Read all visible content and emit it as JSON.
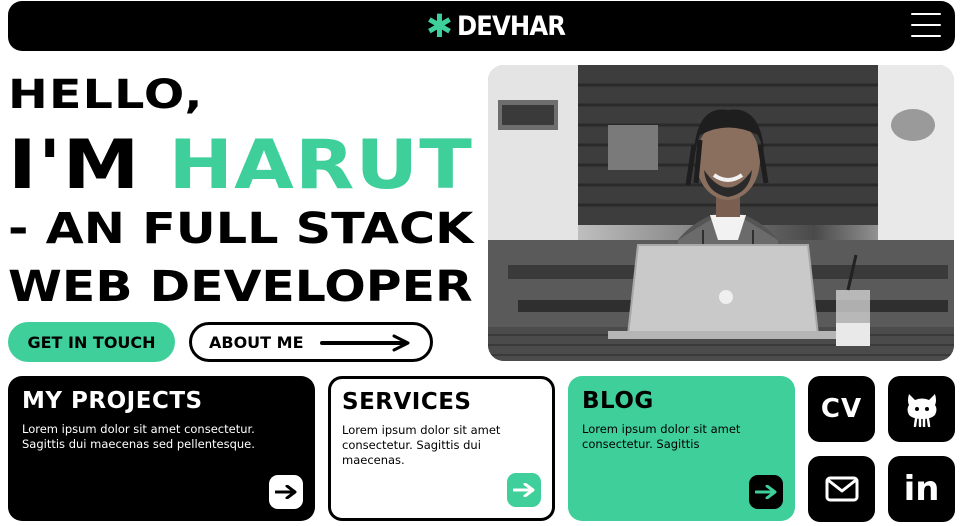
{
  "header": {
    "logo_text": "DEVHAR",
    "logo_icon": "asterisk-icon",
    "menu_icon": "hamburger-menu-icon"
  },
  "hero": {
    "line1": "HELLO,",
    "line2_prefix": "I'M ",
    "line2_name": "HARUT",
    "line3": "- AN FULL STACK",
    "line4": "WEB DEVELOPER",
    "cta_primary": "GET IN TOUCH",
    "cta_secondary": "ABOUT ME",
    "photo_icon": "portrait-photo"
  },
  "cards": {
    "projects": {
      "title": "MY PROJECTS",
      "text": "Lorem ipsum dolor sit amet consectetur. Sagittis dui maecenas sed pellentesque."
    },
    "services": {
      "title": "SERVICES",
      "text": "Lorem ipsum dolor sit amet consectetur. Sagittis dui maecenas."
    },
    "blog": {
      "title": "BLOG",
      "text": "Lorem ipsum dolor sit amet consectetur. Sagittis"
    }
  },
  "links": {
    "cv": "CV",
    "linkedin": "in",
    "github_icon": "github-octocat-icon",
    "mail_icon": "mail-icon"
  },
  "colors": {
    "accent": "#3ecf9a",
    "dark": "#000000",
    "light": "#ffffff"
  }
}
